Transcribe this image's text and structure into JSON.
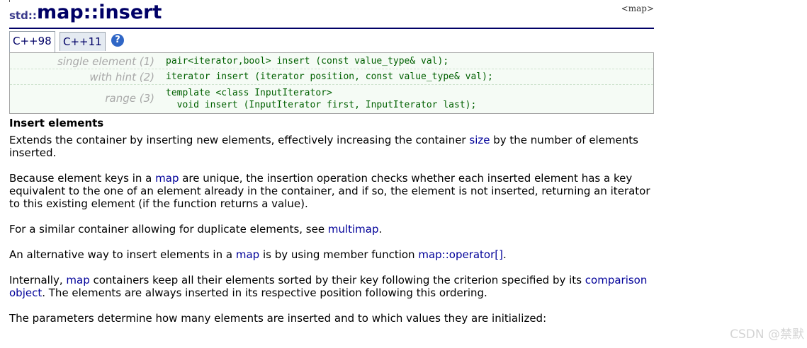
{
  "header": {
    "namespace": "std::",
    "title": "map::insert",
    "tag": "<map>"
  },
  "tabs": [
    {
      "label": "C++98",
      "active": true
    },
    {
      "label": "C++11",
      "active": false
    }
  ],
  "help_icon": "?",
  "prototypes": [
    {
      "label": "single element (1)",
      "code": "pair<iterator,bool> insert (const value_type& val);"
    },
    {
      "label": "with hint (2)",
      "code": "iterator insert (iterator position, const value_type& val);"
    },
    {
      "label": "range (3)",
      "code_line1": "template <class InputIterator>",
      "code_line2": "  void insert (InputIterator first, InputIterator last);"
    }
  ],
  "section": {
    "heading": "Insert elements"
  },
  "paragraphs": {
    "p1": {
      "t1": "Extends the container by inserting new elements, effectively increasing the container ",
      "link1": "size",
      "t2": " by the number of elements inserted."
    },
    "p2": {
      "t1": "Because element keys in a ",
      "link1": "map",
      "t2": " are unique, the insertion operation checks whether each inserted element has a key equivalent to the one of an element already in the container, and if so, the element is not inserted, returning an iterator to this existing element (if the function returns a value)."
    },
    "p3": {
      "t1": "For a similar container allowing for duplicate elements, see ",
      "link1": "multimap",
      "t2": "."
    },
    "p4": {
      "t1": "An alternative way to insert elements in a ",
      "link1": "map",
      "t2": " is by using member function ",
      "link2": "map::operator[]",
      "t3": "."
    },
    "p5": {
      "t1": "Internally, ",
      "link1": "map",
      "t2": " containers keep all their elements sorted by their key following the criterion specified by its ",
      "link2": "comparison object",
      "t3": ". The elements are always inserted in its respective position following this ordering."
    },
    "p6": {
      "t1": "The parameters determine how many elements are inserted and to which values they are initialized:"
    }
  },
  "watermark": "CSDN @禁默"
}
